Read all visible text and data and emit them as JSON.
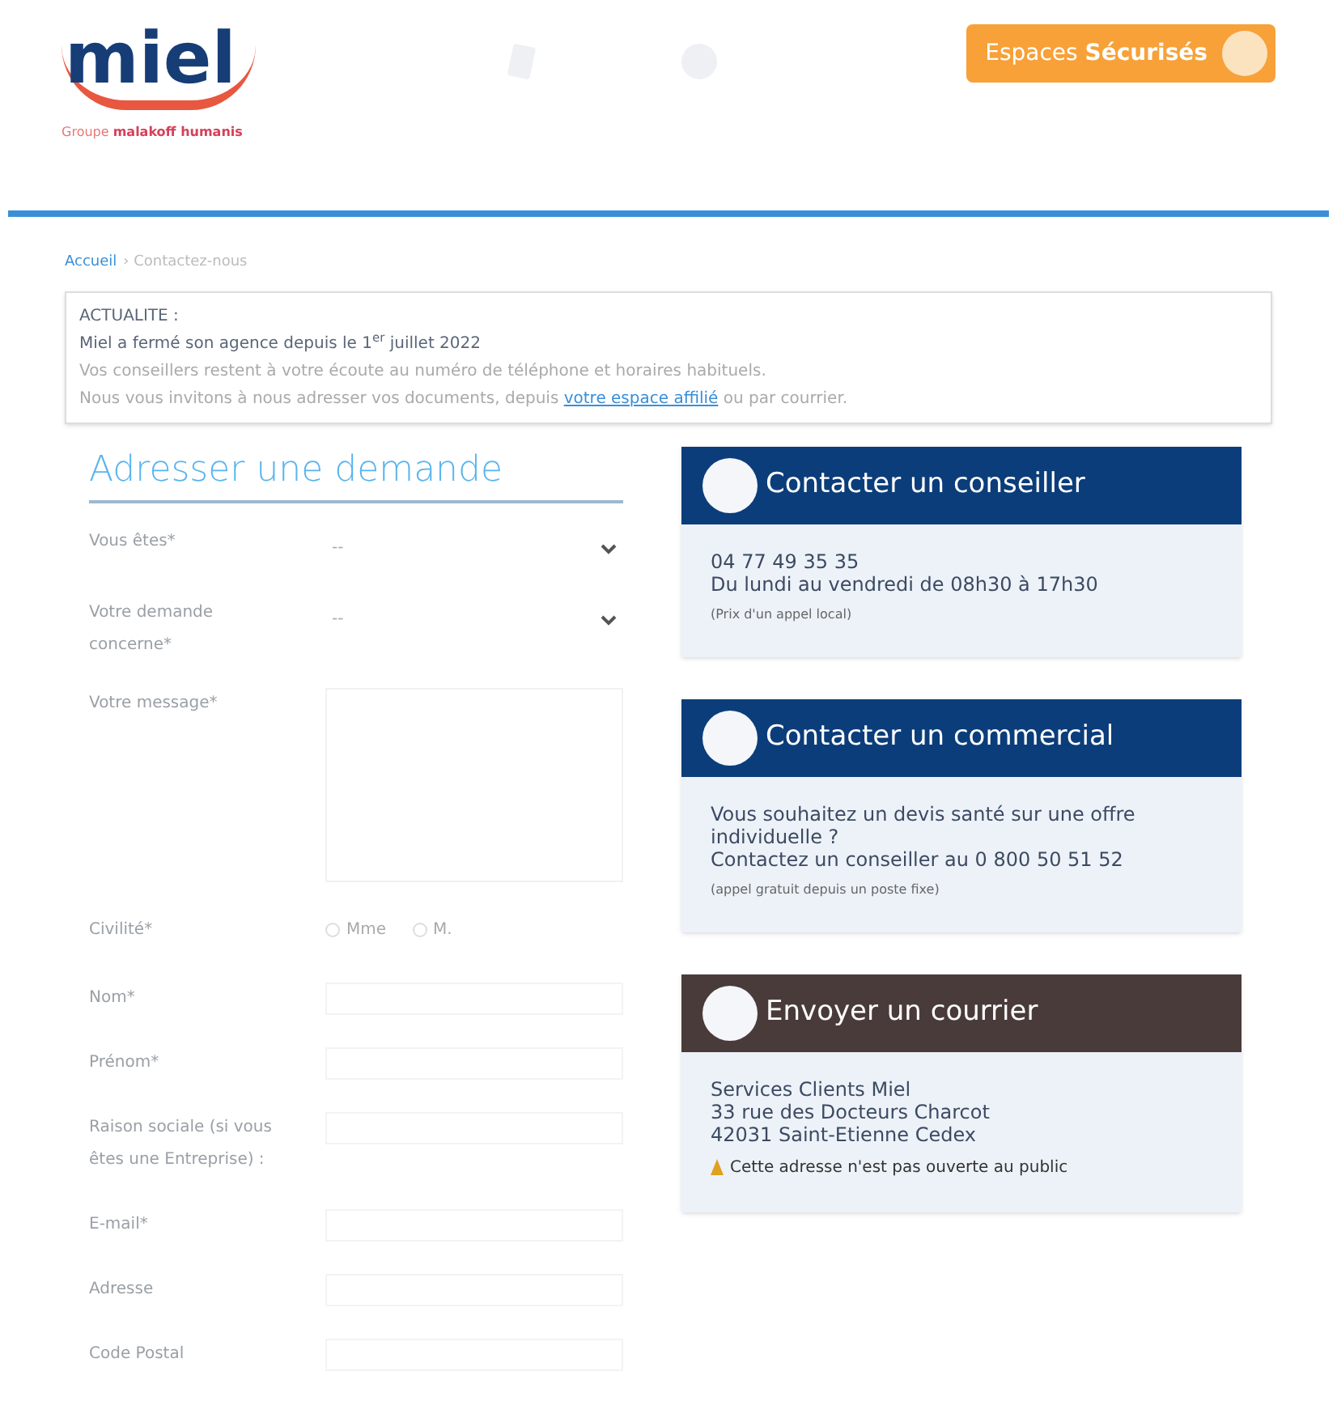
{
  "header": {
    "logo": "miel",
    "tagline_prefix": "Groupe ",
    "tagline_brand": "malakoff humanis",
    "secure_button": {
      "label": "Espaces",
      "label_bold": "Sécurisés"
    }
  },
  "breadcrumb_separator": "›",
  "breadcrumb": [
    {
      "label": "Accueil",
      "kind": "link"
    },
    {
      "label": "Contactez-nous",
      "kind": "current"
    }
  ],
  "notice": {
    "title": "ACTUALITE :",
    "lines": [
      "Miel a fermé son agence depuis le 1$^{er}$ juillet 2022",
      "Vos conseillers restent à votre écoute au numéro de téléphone et horaires habituels."
    ],
    "last_line_before": "Nous vous invitons à nous adresser vos documents, depuis ",
    "link": "votre espace affilié",
    "last_line_after": " ou par courrier."
  },
  "form": {
    "title": "Adresser une demande",
    "fields": [
      {
        "kind": "select",
        "label": "Vous êtes*",
        "value": "--"
      },
      {
        "kind": "select",
        "label": "Votre demande concerne*",
        "value": "--"
      },
      {
        "kind": "textarea",
        "label": "Votre message*"
      },
      {
        "kind": "radio",
        "label": "Civilité*",
        "options": [
          {
            "label": "Mme",
            "selected": false
          },
          {
            "label": "M.",
            "selected": false
          }
        ]
      },
      {
        "kind": "text",
        "label": "Nom*"
      },
      {
        "kind": "text",
        "label": "Prénom*"
      },
      {
        "kind": "text",
        "label": "Raison sociale (si vous êtes une Entreprise) :"
      },
      {
        "kind": "text",
        "label": "E-mail*"
      },
      {
        "kind": "text",
        "label": "Adresse"
      },
      {
        "kind": "text",
        "label": "Code Postal"
      }
    ]
  },
  "cards": [
    {
      "title": "Contacter un conseiller",
      "color": "#0b3d7a",
      "lines": [
        "04 77 49 35 35",
        "Du lundi au vendredi de 08h30 à 17h30"
      ],
      "note": "(Prix d'un appel local)",
      "warning": false
    },
    {
      "title": "Contacter un commercial",
      "color": "#0b3d7a",
      "lines": [
        "Vous souhaitez un devis santé sur une offre individuelle ?",
        "Contactez un conseiller au 0 800 50 51 52"
      ],
      "note": "(appel gratuit depuis un poste fixe)",
      "warning": false
    },
    {
      "title": "Envoyer un courrier",
      "color": "#4a3b3b",
      "lines": [
        "Services Clients Miel",
        "33 rue des Docteurs Charcot",
        "42031 Saint-Etienne Cedex"
      ],
      "note": "Cette adresse n'est pas ouverte au public",
      "warning": true
    }
  ]
}
